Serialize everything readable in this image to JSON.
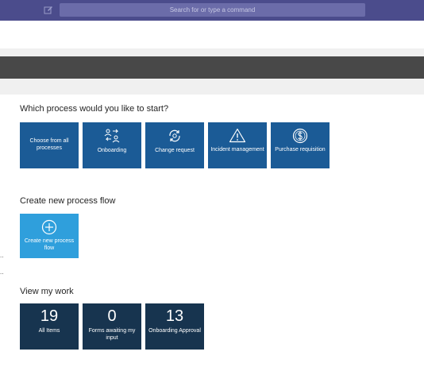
{
  "topbar": {
    "search_placeholder": "Search for or type a command",
    "compose_icon": "compose-icon"
  },
  "start_section": {
    "heading": "Which process would you like to start?",
    "tiles": [
      {
        "label": "Choose from all processes",
        "icon": null
      },
      {
        "label": "Onboarding",
        "icon": "people-swap-icon"
      },
      {
        "label": "Change request",
        "icon": "refresh-gear-icon"
      },
      {
        "label": "Incident management",
        "icon": "warning-icon"
      },
      {
        "label": "Purchase requisition",
        "icon": "dollar-icon"
      }
    ]
  },
  "create_section": {
    "heading": "Create new process flow",
    "tile": {
      "label": "Create new process flow",
      "icon": "plus-circle-icon"
    }
  },
  "work_section": {
    "heading": "View my work",
    "tiles": [
      {
        "count": "19",
        "label": "All Items"
      },
      {
        "count": "0",
        "label": "Forms awaiting my input"
      },
      {
        "count": "13",
        "label": "Onboarding Approval"
      }
    ]
  },
  "side_dots": [
    "..",
    ".."
  ],
  "colors": {
    "topbar": "#4b4c8c",
    "tile_blue": "#1b5b96",
    "tile_light_blue": "#2f9fdc",
    "tile_navy": "#17344f",
    "dark_bar": "#484848"
  }
}
